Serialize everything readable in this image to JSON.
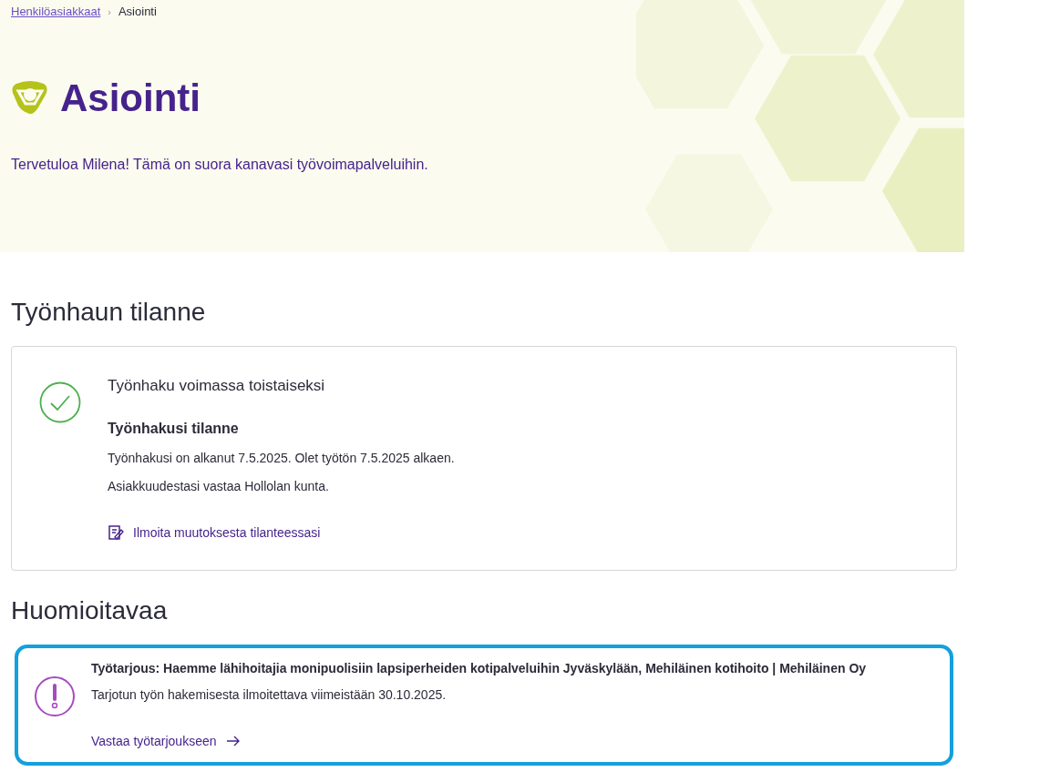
{
  "breadcrumb": [
    {
      "label": "Henkilöasiakkaat",
      "link": true
    },
    {
      "separator": "›",
      "label": "Asiointi",
      "link": false
    }
  ],
  "hero": {
    "title": "Asiointi",
    "welcome": "Tervetuloa Milena! Tämä on suora kanavasi työvoimapalveluihin."
  },
  "status_section": {
    "heading": "Työnhaun tilanne",
    "card": {
      "kind": "success",
      "title": "Työnhaku voimassa toistaiseksi",
      "subtitle": "Työnhakusi tilanne",
      "lines": [
        "Työnhakusi on alkanut 7.5.2025. Olet työtön 7.5.2025 alkaen.",
        "Asiakkuudestasi vastaa Hollolan kunta."
      ],
      "link": "Ilmoita muutoksesta tilanteessasi"
    }
  },
  "notices_section": {
    "heading": "Huomioitavaa",
    "items": [
      {
        "focused": true,
        "title": "Työtarjous: Haemme lähihoitajia monipuolisiin lapsiperheiden kotipalveluihin Jyväskylään, Mehiläinen kotihoito | Mehiläinen Oy",
        "text": "Tarjotun työn hakemisesta ilmoitettava viimeistään 30.10.2025.",
        "link": "Vastaa työtarjoukseen"
      }
    ]
  }
}
